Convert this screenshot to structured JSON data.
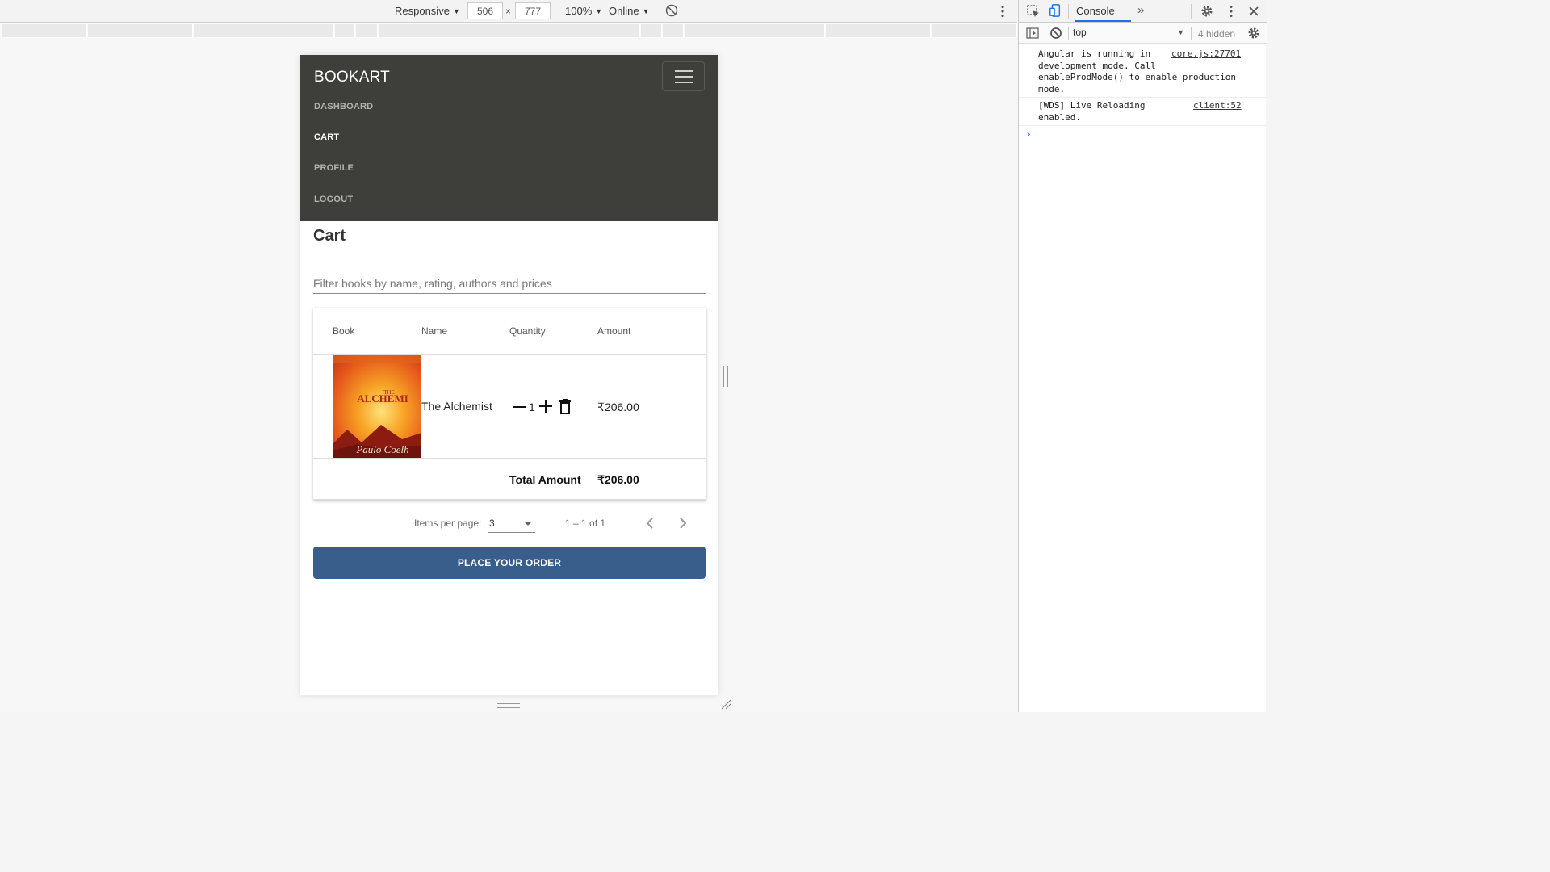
{
  "device_toolbar": {
    "mode": "Responsive",
    "width": "506",
    "height": "777",
    "times": "×",
    "zoom": "100%",
    "network": "Online"
  },
  "app": {
    "brand": "BOOKART",
    "nav": [
      {
        "label": "DASHBOARD",
        "active": false
      },
      {
        "label": "CART",
        "active": true
      },
      {
        "label": "PROFILE",
        "active": false
      },
      {
        "label": "LOGOUT",
        "active": false
      }
    ],
    "page_title": "Cart",
    "filter_placeholder": "Filter books by name, rating, authors and prices",
    "table": {
      "headers": [
        "Book",
        "Name",
        "Quantity",
        "Amount"
      ],
      "rows": [
        {
          "name": "The Alchemist",
          "quantity": "1",
          "amount": "₹206.00"
        }
      ],
      "total_label": "Total Amount",
      "total_value": "₹206.00"
    },
    "paginator": {
      "items_per_page_label": "Items per page:",
      "items_per_page": "3",
      "range": "1 – 1 of 1"
    },
    "place_order": "PLACE YOUR ORDER",
    "colors": {
      "navbar": "#3e3e3a",
      "button": "#385e8c"
    }
  },
  "devtools": {
    "tab": "Console",
    "more": "»",
    "context": "top",
    "hidden": "4 hidden",
    "messages": [
      {
        "text": "Angular is running in\ndevelopment mode. Call\nenableProdMode() to enable production\nmode.",
        "source": "core.js:27701"
      },
      {
        "text": "[WDS] Live Reloading\nenabled.",
        "source": "client:52"
      }
    ],
    "prompt": "›"
  }
}
